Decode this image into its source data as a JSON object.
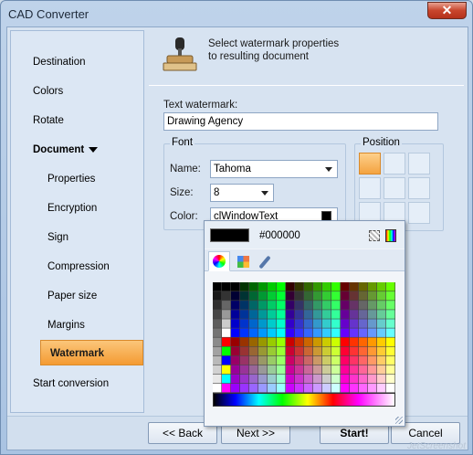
{
  "window": {
    "title": "CAD Converter",
    "close_label": "✕"
  },
  "sidebar": {
    "items": [
      {
        "label": "Destination"
      },
      {
        "label": "Colors"
      },
      {
        "label": "Rotate"
      },
      {
        "label": "Document"
      },
      {
        "label": "Properties"
      },
      {
        "label": "Encryption"
      },
      {
        "label": "Sign"
      },
      {
        "label": "Compression"
      },
      {
        "label": "Paper size"
      },
      {
        "label": "Margins"
      },
      {
        "label": "Watermark"
      },
      {
        "label": "Start conversion"
      }
    ]
  },
  "main": {
    "header_line1": "Select watermark properties",
    "header_line2": "to resulting document",
    "text_watermark_label": "Text watermark:",
    "text_watermark_value": "Drawing Agency",
    "font": {
      "group_title": "Font",
      "name_label": "Name:",
      "name_value": "Tahoma",
      "size_label": "Size:",
      "size_value": "8",
      "color_label": "Color:",
      "color_value": "clWindowText",
      "color_swatch": "#000000"
    },
    "position": {
      "group_title": "Position",
      "selected": "top-left"
    }
  },
  "palette": {
    "hex": "#000000",
    "current_color": "#000000",
    "tabs": [
      "color-wheel",
      "swatches",
      "eyedropper"
    ]
  },
  "buttons": {
    "back": "<< Back",
    "next": "Next >>",
    "start": "Start!",
    "cancel": "Cancel"
  },
  "accent_colors": {
    "active_item": "#f49b33",
    "frame": "#a9c3e2"
  },
  "watermark_text": "JetScreenshot"
}
